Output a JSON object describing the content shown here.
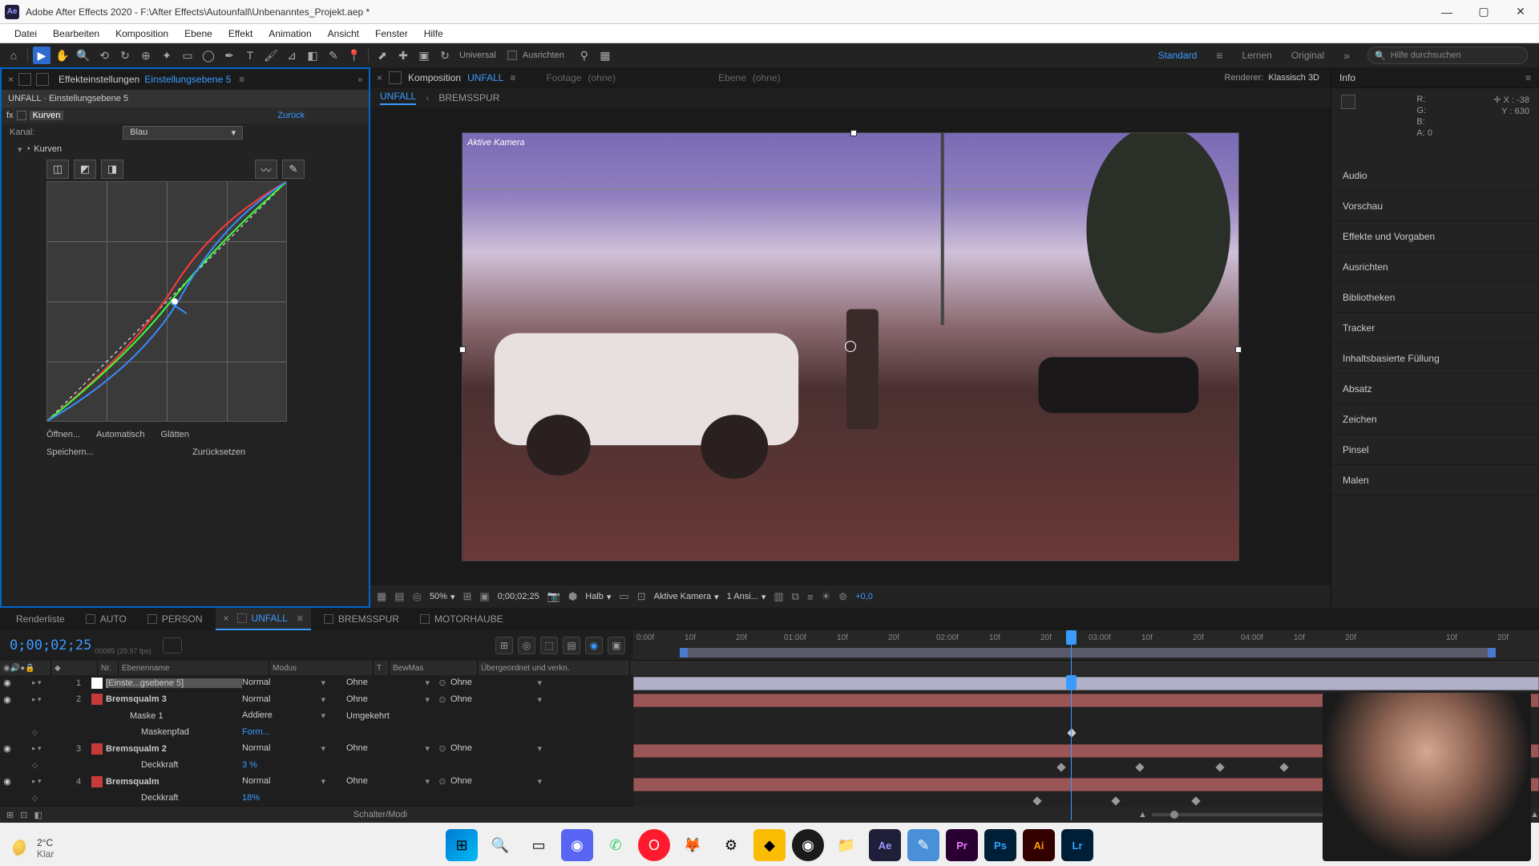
{
  "window": {
    "title": "Adobe After Effects 2020 - F:\\After Effects\\Autounfall\\Unbenanntes_Projekt.aep *",
    "app_abbrev": "Ae"
  },
  "menu": [
    "Datei",
    "Bearbeiten",
    "Komposition",
    "Ebene",
    "Effekt",
    "Animation",
    "Ansicht",
    "Fenster",
    "Hilfe"
  ],
  "toolbar": {
    "universal": "Universal",
    "ausrichten": "Ausrichten"
  },
  "workspaces": {
    "standard": "Standard",
    "lernen": "Lernen",
    "original": "Original"
  },
  "search_placeholder": "Hilfe durchsuchen",
  "effect_controls": {
    "tab": "Effekteinstellungen",
    "layer": "Einstellungsebene 5",
    "header": "UNFALL · Einstellungsebene 5",
    "fx_name": "Kurven",
    "zuruck": "Zurück",
    "kanal_label": "Kanal:",
    "kanal_value": "Blau",
    "kurven_label": "Kurven",
    "open": "Öffnen...",
    "auto": "Automatisch",
    "smooth": "Glätten",
    "save": "Speichern...",
    "reset": "Zurücksetzen"
  },
  "composition": {
    "tab_label": "Komposition",
    "tab_name": "UNFALL",
    "footage": "Footage",
    "ebene": "Ebene",
    "none": "(ohne)",
    "renderer_label": "Renderer:",
    "renderer_value": "Klassisch 3D",
    "bc_current": "UNFALL",
    "bc_child": "BREMSSPUR",
    "camera_label": "Aktive Kamera"
  },
  "viewer": {
    "zoom": "50%",
    "timecode": "0;00;02;25",
    "res": "Halb",
    "camera": "Aktive Kamera",
    "views": "1 Ansi...",
    "exposure": "+0,0"
  },
  "info": {
    "title": "Info",
    "r_label": "R:",
    "g_label": "G:",
    "b_label": "B:",
    "a_label": "A:",
    "a_val": "0",
    "x_label": "X :",
    "x_val": "-38",
    "y_label": "Y :",
    "y_val": "630"
  },
  "right_panels": [
    "Audio",
    "Vorschau",
    "Effekte und Vorgaben",
    "Ausrichten",
    "Bibliotheken",
    "Tracker",
    "Inhaltsbasierte Füllung",
    "Absatz",
    "Zeichen",
    "Pinsel",
    "Malen"
  ],
  "timeline_tabs": {
    "render": "Renderliste",
    "auto": "AUTO",
    "person": "PERSON",
    "unfall": "UNFALL",
    "bremsspur": "BREMSSPUR",
    "motorhaube": "MOTORHAUBE"
  },
  "timeline": {
    "timecode": "0;00;02;25",
    "sub": "00085 (29.97 fps)",
    "cols": {
      "nr": "Nr.",
      "ebene": "Ebenenname",
      "modus": "Modus",
      "t": "T",
      "bewmas": "BewMas",
      "ueber": "Übergeordnet und verkn."
    },
    "time_marks": [
      "0:00f",
      "10f",
      "20f",
      "01:00f",
      "10f",
      "20f",
      "02:00f",
      "10f",
      "20f",
      "03:00f",
      "10f",
      "20f",
      "04:00f",
      "10f",
      "20f",
      "10f",
      "20f"
    ],
    "footer_modi": "Schalter/Modi"
  },
  "layers": [
    {
      "num": "1",
      "color": "#ffffff",
      "name": "[Einste...gsebene 5]",
      "mode": "Normal",
      "mask": "Ohne",
      "parent": "Ohne",
      "bold": false,
      "sel": true
    },
    {
      "num": "2",
      "color": "#c73a3a",
      "name": "Bremsqualm 3",
      "mode": "Normal",
      "mask": "Ohne",
      "parent": "Ohne",
      "bold": true
    },
    {
      "num": "",
      "color": "",
      "name": "Maske 1",
      "mode": "Addiere",
      "mask": "Umgekehrt",
      "parent": "",
      "indent": 30
    },
    {
      "num": "",
      "color": "",
      "name": "Maskenpfad",
      "mode": "Form...",
      "mask": "",
      "parent": "",
      "indent": 44,
      "bluemode": true
    },
    {
      "num": "3",
      "color": "#c73a3a",
      "name": "Bremsqualm 2",
      "mode": "Normal",
      "mask": "Ohne",
      "parent": "Ohne",
      "bold": true
    },
    {
      "num": "",
      "color": "",
      "name": "Deckkraft",
      "mode": "3 %",
      "mask": "",
      "parent": "",
      "indent": 44,
      "bluemode": true
    },
    {
      "num": "4",
      "color": "#c73a3a",
      "name": "Bremsqualm",
      "mode": "Normal",
      "mask": "Ohne",
      "parent": "Ohne",
      "bold": true
    },
    {
      "num": "",
      "color": "",
      "name": "Deckkraft",
      "mode": "18%",
      "mask": "",
      "parent": "",
      "indent": 44,
      "bluemode": true
    }
  ],
  "weather": {
    "temp": "2°C",
    "cond": "Klar"
  }
}
